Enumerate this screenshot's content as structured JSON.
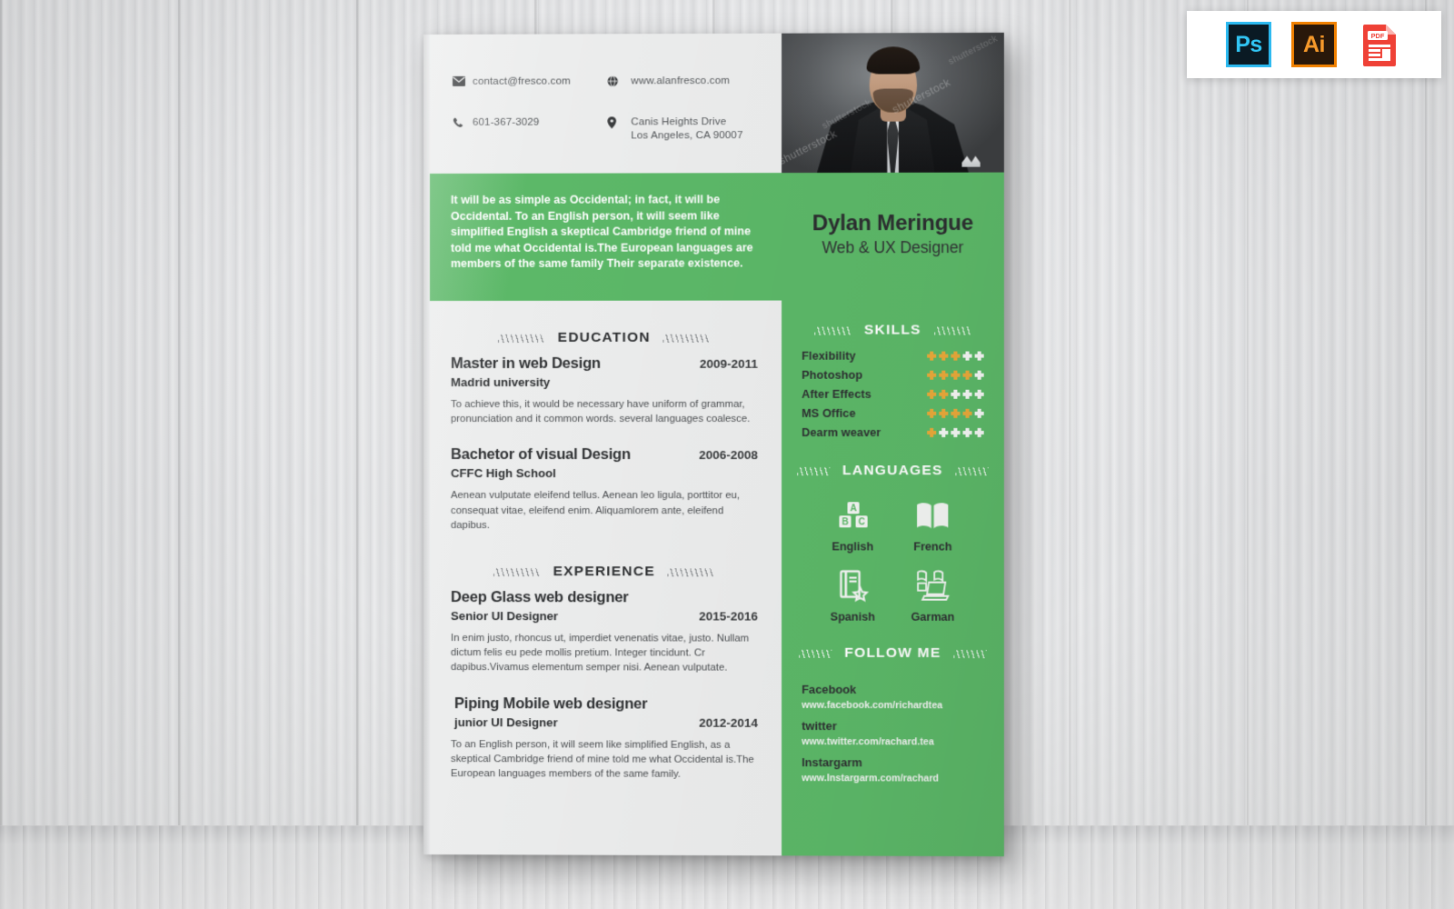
{
  "badges": {
    "items": [
      {
        "id": "photoshop",
        "label": "Ps"
      },
      {
        "id": "illustrator",
        "label": "Ai"
      },
      {
        "id": "pdf",
        "label": "PDF"
      }
    ]
  },
  "contact": {
    "email": "contact@fresco.com",
    "website": "www.alanfresco.com",
    "phone": "601-367-3029",
    "address_line1": "Canis Heights Drive",
    "address_line2": "Los Angeles, CA 90007"
  },
  "profile": {
    "name": "Dylan Meringue",
    "role": "Web & UX Designer",
    "intro": "It will be as simple as Occidental; in fact, it will be Occidental. To an English person, it will seem like simplified English a skeptical Cambridge friend of mine told me what Occidental is.The European languages are members of the same family Their separate existence."
  },
  "education": {
    "title": "EDUCATION",
    "entries": [
      {
        "title": "Master in web Design",
        "date": "2009-2011",
        "sub": "Madrid university",
        "body": "To achieve this, it would be necessary  have uniform of grammar, pronunciation and it common words. several languages coalesce."
      },
      {
        "title": "Bachetor of visual Design",
        "date": "2006-2008",
        "sub": "CFFC High School",
        "body": "Aenean vulputate eleifend tellus. Aenean leo ligula, porttitor eu, consequat vitae, eleifend  enim. Aliquamlorem ante, eleifend dapibus."
      }
    ]
  },
  "experience": {
    "title": "EXPERIENCE",
    "entries": [
      {
        "title": "Deep Glass web designer",
        "sub": "Senior UI Designer",
        "date": "2015-2016",
        "body": "In enim justo, rhoncus ut, imperdiet venenatis vitae, justo. Nullam dictum felis eu pede mollis pretium. Integer tincidunt. Cr dapibus.Vivamus elementum semper nisi. Aenean vulputate."
      },
      {
        "title": "Piping Mobile web designer",
        "sub": "junior UI Designer",
        "date": "2012-2014",
        "body": "To an English person, it will seem like simplified English, as a skeptical Cambridge friend of mine told me what Occidental is.The European languages members of the same family."
      }
    ]
  },
  "skills": {
    "title": "SKILLS",
    "max": 5,
    "items": [
      {
        "name": "Flexibility",
        "rating": 3
      },
      {
        "name": "Photoshop",
        "rating": 4
      },
      {
        "name": "After Effects",
        "rating": 2
      },
      {
        "name": "MS Office",
        "rating": 4
      },
      {
        "name": "Dearm weaver",
        "rating": 1
      }
    ]
  },
  "languages": {
    "title": "LANGUAGES",
    "items": [
      {
        "label": "English",
        "icon": "abc-blocks-icon"
      },
      {
        "label": "French",
        "icon": "open-book-icon"
      },
      {
        "label": "Spanish",
        "icon": "book-star-icon"
      },
      {
        "label": "Garman",
        "icon": "books-laptop-icon"
      }
    ]
  },
  "follow": {
    "title": "FOLLOW ME",
    "items": [
      {
        "network": "Facebook",
        "url": "www.facebook.com/richardtea"
      },
      {
        "network": "twitter",
        "url": "www.twitter.com/rachard.tea"
      },
      {
        "network": "Instargarm",
        "url": "www.Instargarm.com/rachard"
      }
    ]
  },
  "photo": {
    "watermark": "shutterstock"
  },
  "colors": {
    "green": "#5cb868",
    "gold": "#e9a93a",
    "paper": "#eceded",
    "dark_text": "#2f3133"
  }
}
